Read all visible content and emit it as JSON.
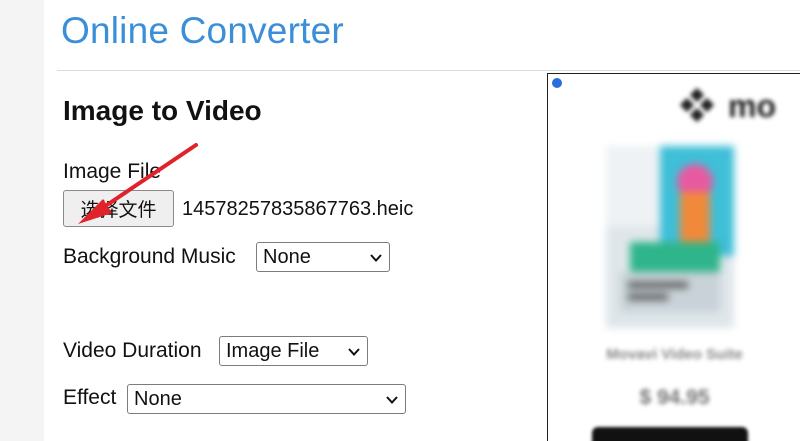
{
  "site": {
    "title": "Online Converter"
  },
  "page": {
    "heading": "Image to Video"
  },
  "form": {
    "image_file_label": "Image File",
    "choose_file_button": "选择文件",
    "selected_file_name": "14578257835867763.heic",
    "background_music_label": "Background Music",
    "background_music_value": "None",
    "video_duration_label": "Video Duration",
    "video_duration_value": "Image File",
    "effect_label": "Effect",
    "effect_value": "None"
  },
  "ad": {
    "brand": "mo",
    "product_name": "Movavi Video Suite",
    "price": "$ 94.95"
  },
  "colors": {
    "title_blue": "#3b8fd8",
    "annotation_arrow": "#e0222a",
    "ad_dot": "#2d6be0"
  },
  "icons": {
    "select_arrow": "chevron-down-icon",
    "annotation": "red-arrow-icon"
  }
}
